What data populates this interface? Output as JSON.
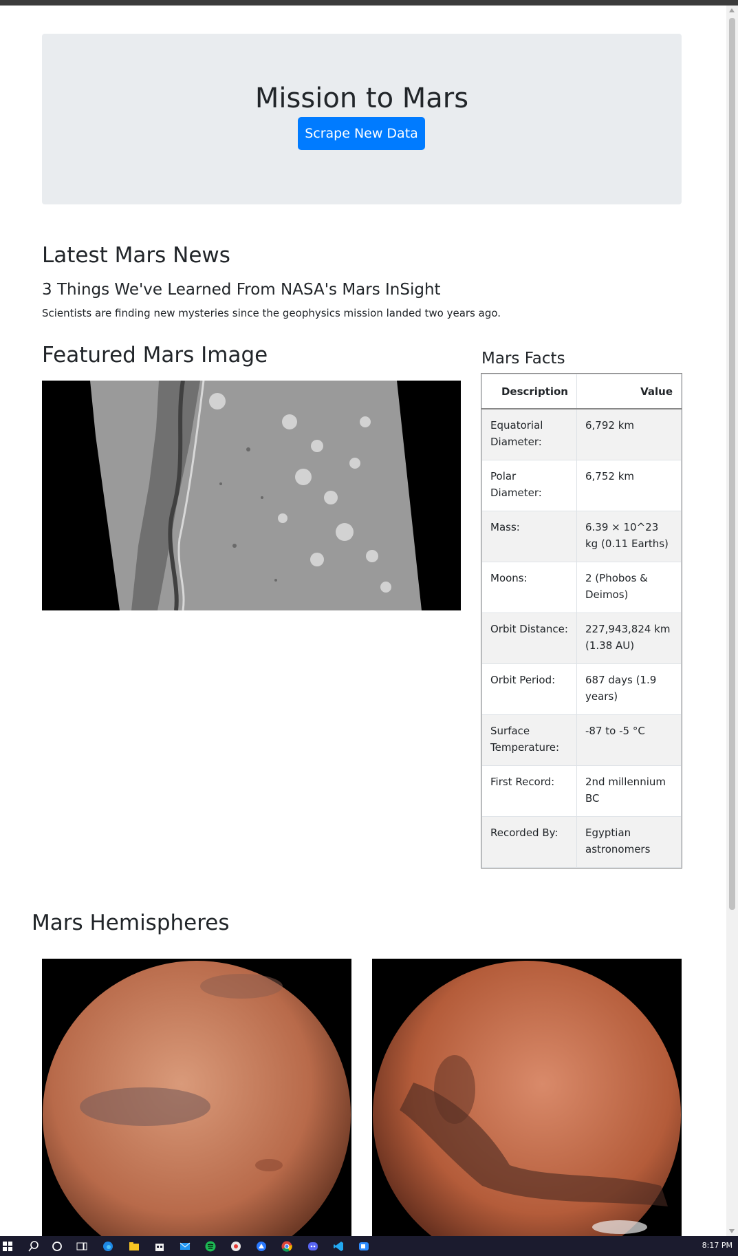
{
  "jumbotron": {
    "title": "Mission to Mars",
    "button_label": "Scrape New Data"
  },
  "news": {
    "heading": "Latest Mars News",
    "title": "3 Things We've Learned From NASA's Mars InSight",
    "paragraph": "Scientists are finding new mysteries since the geophysics mission landed two years ago."
  },
  "featured_image": {
    "heading": "Featured Mars Image"
  },
  "facts": {
    "heading": "Mars Facts",
    "col_description": "Description",
    "col_value": "Value",
    "rows": [
      {
        "label": "Equatorial Diameter:",
        "value": "6,792 km"
      },
      {
        "label": "Polar Diameter:",
        "value": "6,752 km"
      },
      {
        "label": "Mass:",
        "value": "6.39 × 10^23 kg (0.11 Earths)"
      },
      {
        "label": "Moons:",
        "value": "2 (Phobos & Deimos)"
      },
      {
        "label": "Orbit Distance:",
        "value": "227,943,824 km (1.38 AU)"
      },
      {
        "label": "Orbit Period:",
        "value": "687 days (1.9 years)"
      },
      {
        "label": "Surface Temperature:",
        "value": "-87 to -5 °C"
      },
      {
        "label": "First Record:",
        "value": "2nd millennium BC"
      },
      {
        "label": "Recorded By:",
        "value": "Egyptian astronomers"
      }
    ]
  },
  "hemispheres": {
    "heading": "Mars Hemispheres"
  },
  "taskbar": {
    "clock": "8:17 PM",
    "icons": [
      "windows-start-icon",
      "search-icon",
      "cortana-icon",
      "task-view-icon",
      "edge-icon",
      "file-explorer-icon",
      "store-icon",
      "mail-icon",
      "spotify-icon",
      "app-icon",
      "app-icon-2",
      "chrome-icon",
      "discord-icon",
      "vscode-icon",
      "zoom-icon"
    ]
  },
  "colors": {
    "primary": "#007bff",
    "jumbotron_bg": "#e9ecef",
    "taskbar_bg": "#1b1b2e"
  }
}
